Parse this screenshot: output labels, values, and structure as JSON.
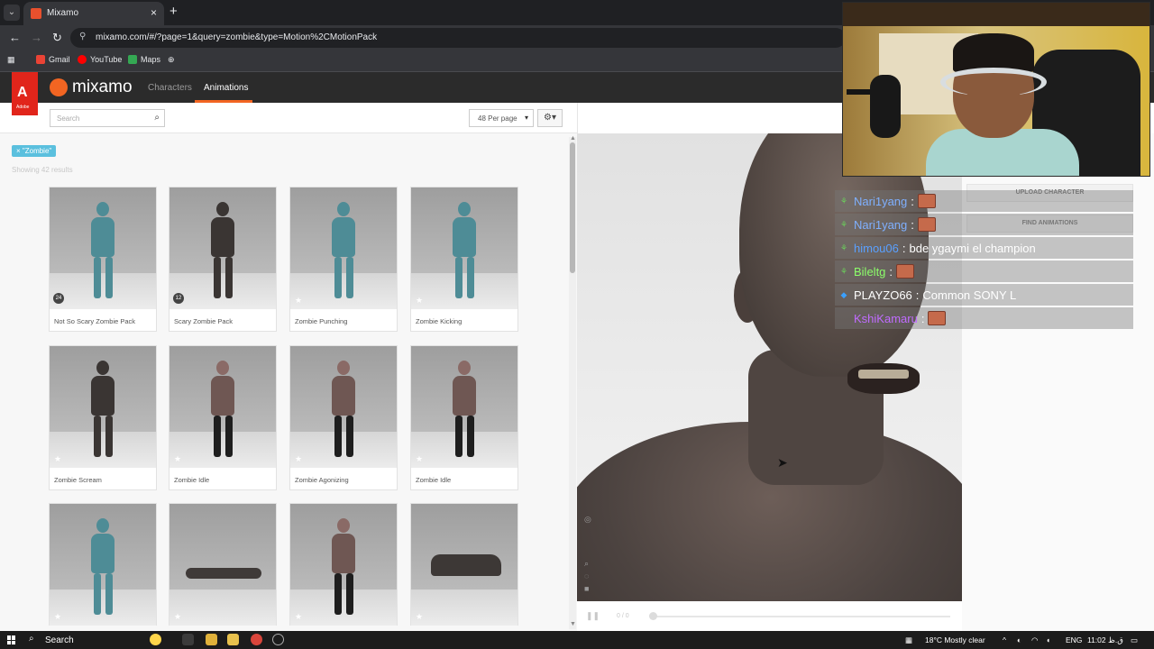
{
  "browser": {
    "tab_title": "Mixamo",
    "url": "mixamo.com/#/?page=1&query=zombie&type=Motion%2CMotionPack",
    "bookmarks": [
      "Gmail",
      "YouTube",
      "Maps"
    ]
  },
  "header": {
    "adobe_label": "Adobe",
    "logo": "mixamo",
    "nav": [
      "Characters",
      "Animations"
    ],
    "active_nav": "Animations"
  },
  "toolbar": {
    "search_placeholder": "Search",
    "per_page": "48 Per page"
  },
  "filter": {
    "chip": "× \"Zombie\"",
    "results": "Showing 42 results"
  },
  "cards": [
    {
      "label": "Not So Scary Zombie Pack",
      "badge": "24",
      "figure": "teal"
    },
    {
      "label": "Scary Zombie Pack",
      "badge": "12",
      "figure": "dark"
    },
    {
      "label": "Zombie Punching",
      "figure": "teal"
    },
    {
      "label": "Zombie Kicking",
      "figure": "teal"
    },
    {
      "label": "Zombie Scream",
      "figure": "dark"
    },
    {
      "label": "Zombie Idle",
      "figure": "pale"
    },
    {
      "label": "Zombie Agonizing",
      "figure": "pale"
    },
    {
      "label": "Zombie Idle",
      "figure": "pale"
    },
    {
      "label": "",
      "figure": "teal"
    },
    {
      "label": "",
      "figure": "lying"
    },
    {
      "label": "",
      "figure": "pale"
    },
    {
      "label": "",
      "figure": "crawl"
    }
  ],
  "viewer": {
    "upload_btn": "UPLOAD CHARACTER",
    "find_btn": "FIND ANIMATIONS",
    "frame_counter": "0 / 0"
  },
  "chat": [
    {
      "user": "Nari1yang",
      "color": "#7fb0ff",
      "message": "",
      "emote": true
    },
    {
      "user": "Nari1yang",
      "color": "#7fb0ff",
      "message": "",
      "emote": true
    },
    {
      "user": "himou06",
      "color": "#5aa0ff",
      "message": "bde ygaymi el champion",
      "emote": false
    },
    {
      "user": "Bileltg",
      "color": "#8cff6a",
      "message": "",
      "emote": true
    },
    {
      "user": "PLAYZO66",
      "color": "#ffffff",
      "message": "Common SONY L",
      "emote": false
    },
    {
      "user": "KshiKamaru",
      "color": "#c06cff",
      "message": "",
      "emote": true
    }
  ],
  "taskbar": {
    "search": "Search",
    "weather": "18°C  Mostly clear",
    "lang": "ENG",
    "time": "11:02 ق.ظ"
  }
}
